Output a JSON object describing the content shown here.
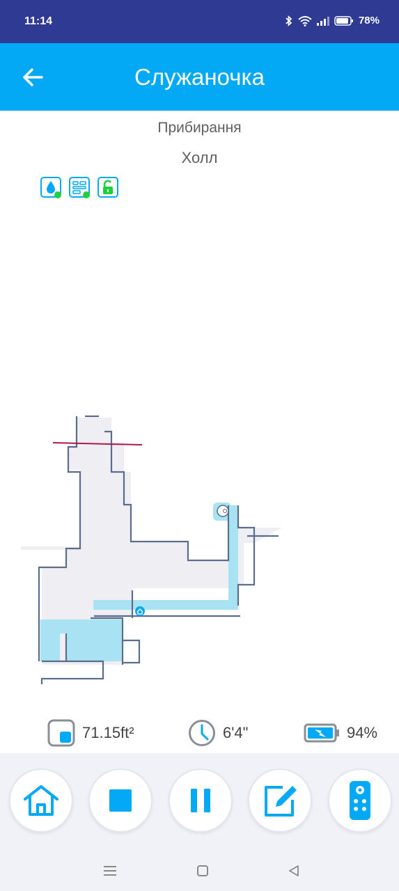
{
  "status": {
    "time": "11:14",
    "battery": "78%"
  },
  "header": {
    "title": "Служаночка"
  },
  "cleaning": {
    "mode": "Прибирання",
    "room": "Холл"
  },
  "indicators": [
    "water-drop-icon",
    "mop-settings-icon",
    "unlock-icon"
  ],
  "stats": {
    "area": "71.15ft²",
    "time": "6'4\"",
    "battery": "94%"
  },
  "controls": [
    "home",
    "stop",
    "pause",
    "edit",
    "remote"
  ],
  "colors": {
    "status_bar": "#2f3a93",
    "accent": "#03a9f4",
    "map_wall": "#5a6d8f",
    "map_floor": "#eeeef3",
    "map_cleaned": "#a8e2f3",
    "virtual_wall": "#b0174a"
  }
}
